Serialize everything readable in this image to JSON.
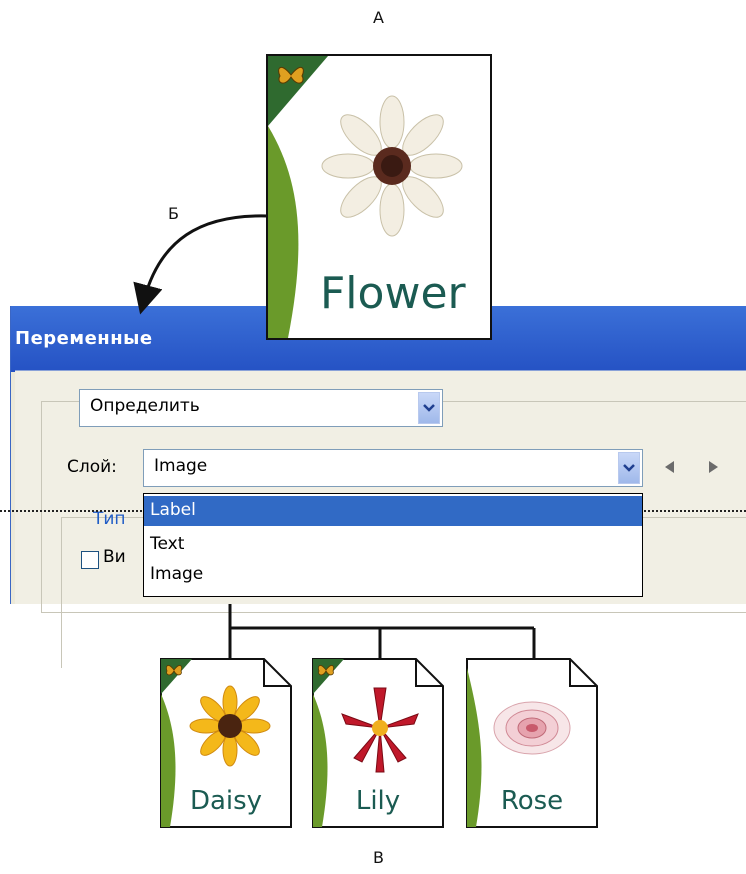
{
  "callouts": {
    "a": "A",
    "b": "Б",
    "c": "В"
  },
  "hero": {
    "word": "Flower"
  },
  "dialog": {
    "title": "Переменные",
    "define_combo": {
      "value": "Определить"
    },
    "layer_label": "Слой:",
    "layer_combo": {
      "value": "Image"
    },
    "dropdown_options": [
      "Label",
      "Text",
      "Image"
    ],
    "selected_option_index": 0,
    "type_label": "Тип",
    "visible_label_fragment": "Ви"
  },
  "documents": [
    {
      "word": "Daisy"
    },
    {
      "word": "Lily"
    },
    {
      "word": "Rose"
    }
  ],
  "colors": {
    "title_bar": "#2a5bd0",
    "selection": "#316ac5",
    "brand_green": "#2f6f2f",
    "word_teal": "#1b5b52"
  },
  "icons": [
    "butterfly-icon",
    "chevron-down-icon",
    "triangle-left-icon",
    "triangle-right-icon"
  ]
}
